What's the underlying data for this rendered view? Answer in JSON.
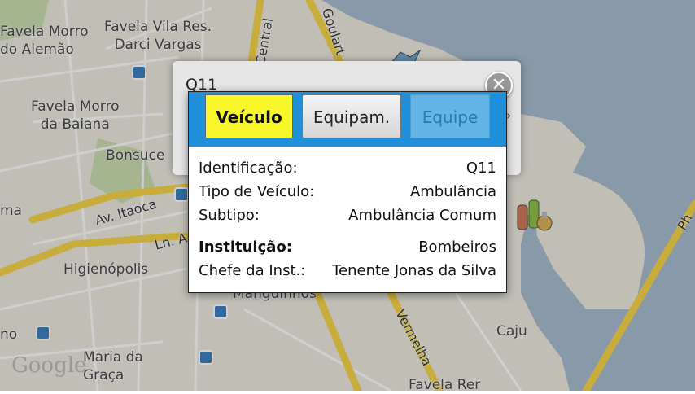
{
  "map": {
    "labels": {
      "favela_morro_alemao": "Favela Morro\ndo Alemão",
      "favela_vila_res": "Favela Vila Res.\nDarci Vargas",
      "favela_morro_baiana": "Favela Morro\nda Baiana",
      "bonsucesso": "Bonsuce",
      "av_itaoca": "Av. Itaoca",
      "ln_a": "Ln. A",
      "higienopolis": "Higienópolis",
      "manguinhos": "Manguinhos",
      "maria_da_graca": "Maria da\nGraça",
      "caju": "Caju",
      "favela_rer": "Favela Rer",
      "central": "Central",
      "goulart": "Goulart",
      "vermelha": "Vermelha",
      "ma": "ma",
      "no": "no",
      "ph": "Ph"
    },
    "provider_logo": "Google",
    "colors": {
      "land": "#ece8df",
      "water": "#a6bccf",
      "road": "#f4d24a",
      "park": "#c8ddb0"
    }
  },
  "back_popup": {
    "title": "Q11"
  },
  "card": {
    "tabs": [
      {
        "label": "Veículo",
        "state": "selected"
      },
      {
        "label": "Equipam.",
        "state": "normal"
      },
      {
        "label": "Equipe",
        "state": "disabled"
      }
    ],
    "rows": [
      {
        "label": "Identificação:",
        "value": "Q11"
      },
      {
        "label": "Tipo de Veículo:",
        "value": "Ambulância"
      },
      {
        "label": "Subtipo:",
        "value": "Ambulância Comum"
      },
      {
        "label": "Instituição:",
        "value": "Bombeiros"
      },
      {
        "label": "Chefe da Inst.:",
        "value": "Tenente Jonas da Silva"
      }
    ],
    "colors": {
      "tabbar": "#1e8fd8",
      "selected_tab": "#f7f72a"
    }
  },
  "icons": {
    "close": "close-icon",
    "marker": "potion-marker-icon",
    "bus_stop": "bus-stop-icon"
  }
}
